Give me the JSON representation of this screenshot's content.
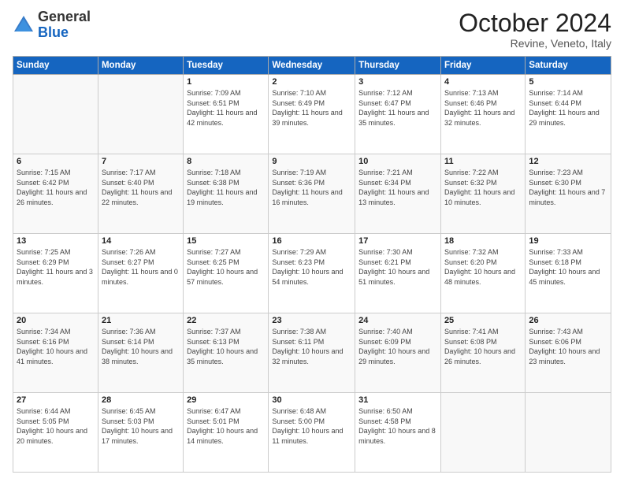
{
  "header": {
    "logo_general": "General",
    "logo_blue": "Blue",
    "month_title": "October 2024",
    "subtitle": "Revine, Veneto, Italy"
  },
  "columns": [
    "Sunday",
    "Monday",
    "Tuesday",
    "Wednesday",
    "Thursday",
    "Friday",
    "Saturday"
  ],
  "weeks": [
    [
      {
        "day": "",
        "info": ""
      },
      {
        "day": "",
        "info": ""
      },
      {
        "day": "1",
        "info": "Sunrise: 7:09 AM\nSunset: 6:51 PM\nDaylight: 11 hours and 42 minutes."
      },
      {
        "day": "2",
        "info": "Sunrise: 7:10 AM\nSunset: 6:49 PM\nDaylight: 11 hours and 39 minutes."
      },
      {
        "day": "3",
        "info": "Sunrise: 7:12 AM\nSunset: 6:47 PM\nDaylight: 11 hours and 35 minutes."
      },
      {
        "day": "4",
        "info": "Sunrise: 7:13 AM\nSunset: 6:46 PM\nDaylight: 11 hours and 32 minutes."
      },
      {
        "day": "5",
        "info": "Sunrise: 7:14 AM\nSunset: 6:44 PM\nDaylight: 11 hours and 29 minutes."
      }
    ],
    [
      {
        "day": "6",
        "info": "Sunrise: 7:15 AM\nSunset: 6:42 PM\nDaylight: 11 hours and 26 minutes."
      },
      {
        "day": "7",
        "info": "Sunrise: 7:17 AM\nSunset: 6:40 PM\nDaylight: 11 hours and 22 minutes."
      },
      {
        "day": "8",
        "info": "Sunrise: 7:18 AM\nSunset: 6:38 PM\nDaylight: 11 hours and 19 minutes."
      },
      {
        "day": "9",
        "info": "Sunrise: 7:19 AM\nSunset: 6:36 PM\nDaylight: 11 hours and 16 minutes."
      },
      {
        "day": "10",
        "info": "Sunrise: 7:21 AM\nSunset: 6:34 PM\nDaylight: 11 hours and 13 minutes."
      },
      {
        "day": "11",
        "info": "Sunrise: 7:22 AM\nSunset: 6:32 PM\nDaylight: 11 hours and 10 minutes."
      },
      {
        "day": "12",
        "info": "Sunrise: 7:23 AM\nSunset: 6:30 PM\nDaylight: 11 hours and 7 minutes."
      }
    ],
    [
      {
        "day": "13",
        "info": "Sunrise: 7:25 AM\nSunset: 6:29 PM\nDaylight: 11 hours and 3 minutes."
      },
      {
        "day": "14",
        "info": "Sunrise: 7:26 AM\nSunset: 6:27 PM\nDaylight: 11 hours and 0 minutes."
      },
      {
        "day": "15",
        "info": "Sunrise: 7:27 AM\nSunset: 6:25 PM\nDaylight: 10 hours and 57 minutes."
      },
      {
        "day": "16",
        "info": "Sunrise: 7:29 AM\nSunset: 6:23 PM\nDaylight: 10 hours and 54 minutes."
      },
      {
        "day": "17",
        "info": "Sunrise: 7:30 AM\nSunset: 6:21 PM\nDaylight: 10 hours and 51 minutes."
      },
      {
        "day": "18",
        "info": "Sunrise: 7:32 AM\nSunset: 6:20 PM\nDaylight: 10 hours and 48 minutes."
      },
      {
        "day": "19",
        "info": "Sunrise: 7:33 AM\nSunset: 6:18 PM\nDaylight: 10 hours and 45 minutes."
      }
    ],
    [
      {
        "day": "20",
        "info": "Sunrise: 7:34 AM\nSunset: 6:16 PM\nDaylight: 10 hours and 41 minutes."
      },
      {
        "day": "21",
        "info": "Sunrise: 7:36 AM\nSunset: 6:14 PM\nDaylight: 10 hours and 38 minutes."
      },
      {
        "day": "22",
        "info": "Sunrise: 7:37 AM\nSunset: 6:13 PM\nDaylight: 10 hours and 35 minutes."
      },
      {
        "day": "23",
        "info": "Sunrise: 7:38 AM\nSunset: 6:11 PM\nDaylight: 10 hours and 32 minutes."
      },
      {
        "day": "24",
        "info": "Sunrise: 7:40 AM\nSunset: 6:09 PM\nDaylight: 10 hours and 29 minutes."
      },
      {
        "day": "25",
        "info": "Sunrise: 7:41 AM\nSunset: 6:08 PM\nDaylight: 10 hours and 26 minutes."
      },
      {
        "day": "26",
        "info": "Sunrise: 7:43 AM\nSunset: 6:06 PM\nDaylight: 10 hours and 23 minutes."
      }
    ],
    [
      {
        "day": "27",
        "info": "Sunrise: 6:44 AM\nSunset: 5:05 PM\nDaylight: 10 hours and 20 minutes."
      },
      {
        "day": "28",
        "info": "Sunrise: 6:45 AM\nSunset: 5:03 PM\nDaylight: 10 hours and 17 minutes."
      },
      {
        "day": "29",
        "info": "Sunrise: 6:47 AM\nSunset: 5:01 PM\nDaylight: 10 hours and 14 minutes."
      },
      {
        "day": "30",
        "info": "Sunrise: 6:48 AM\nSunset: 5:00 PM\nDaylight: 10 hours and 11 minutes."
      },
      {
        "day": "31",
        "info": "Sunrise: 6:50 AM\nSunset: 4:58 PM\nDaylight: 10 hours and 8 minutes."
      },
      {
        "day": "",
        "info": ""
      },
      {
        "day": "",
        "info": ""
      }
    ]
  ]
}
